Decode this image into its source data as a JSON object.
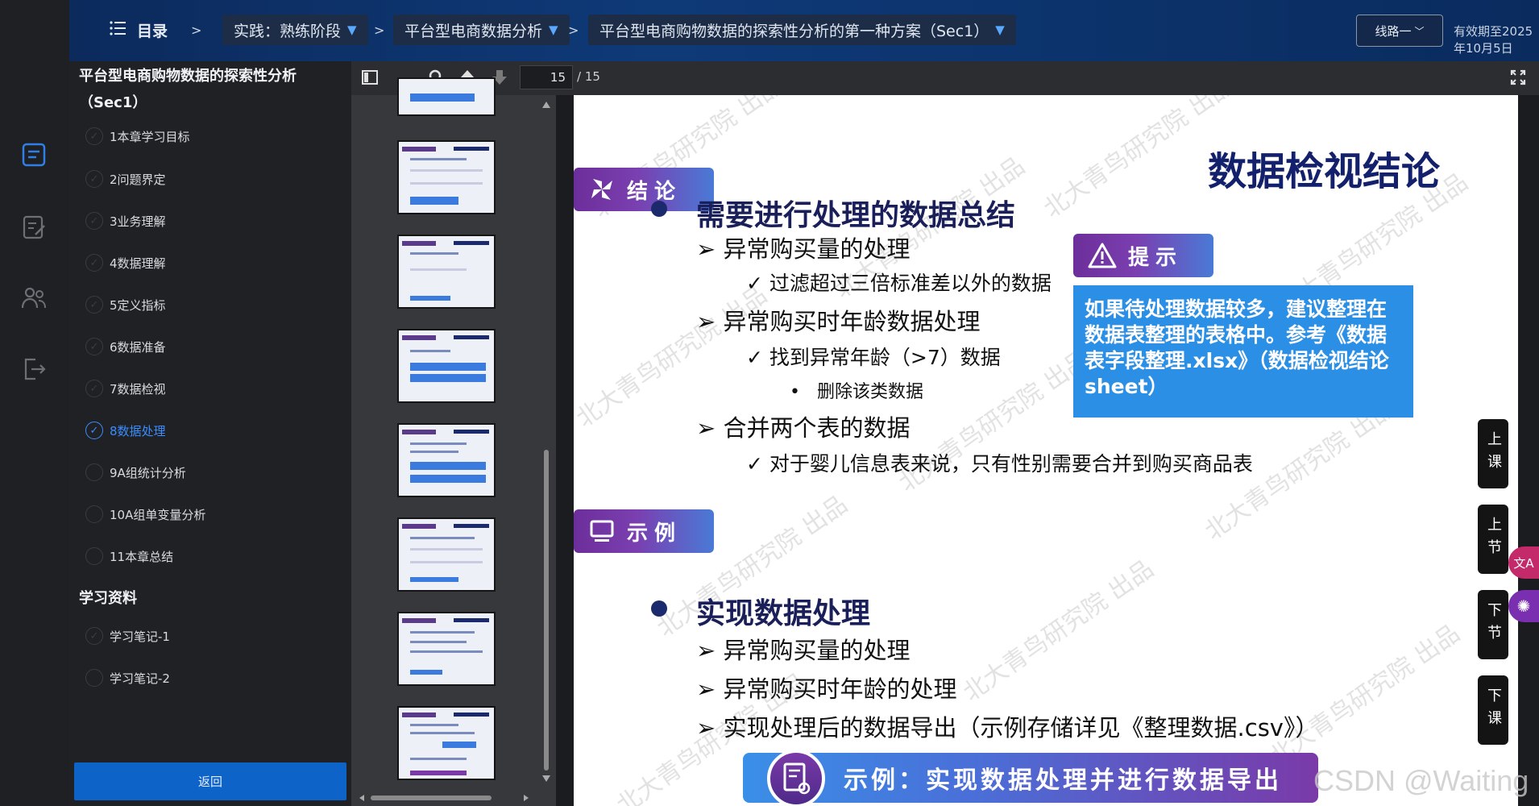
{
  "header": {
    "menu_label": "目录",
    "breadcrumbs": [
      "实践：熟练阶段",
      "平台型电商数据分析",
      "平台型电商购物数据的探索性分析的第一种方案（Sec1）"
    ],
    "route_button": "线路一",
    "validity": "有效期至2025年10月5日"
  },
  "sidebar": {
    "course_title": "平台型电商购物数据的探索性分析（Sec1）",
    "chapters": [
      {
        "label": "1本章学习目标",
        "state": "done"
      },
      {
        "label": "2问题界定",
        "state": "done"
      },
      {
        "label": "3业务理解",
        "state": "done"
      },
      {
        "label": "4数据理解",
        "state": "done"
      },
      {
        "label": "5定义指标",
        "state": "done"
      },
      {
        "label": "6数据准备",
        "state": "done"
      },
      {
        "label": "7数据检视",
        "state": "done"
      },
      {
        "label": "8数据处理",
        "state": "active"
      },
      {
        "label": "9A组统计分析",
        "state": "todo"
      },
      {
        "label": "10A组单变量分析",
        "state": "todo"
      },
      {
        "label": "11本章总结",
        "state": "todo"
      }
    ],
    "materials_title": "学习资料",
    "materials": [
      {
        "label": "学习笔记-1",
        "state": "done"
      },
      {
        "label": "学习笔记-2",
        "state": "todo"
      }
    ],
    "back_button": "返回"
  },
  "viewer": {
    "current_page": "15",
    "total_pages": "/ 15"
  },
  "slide": {
    "title": "数据检视结论",
    "conclusion_tag": "结论",
    "tip_tag": "提示",
    "example_tag": "示例",
    "section1": {
      "heading": "需要进行处理的数据总结",
      "items": [
        {
          "text": "异常购买量的处理",
          "level": 2
        },
        {
          "text": "过滤超过三倍标准差以外的数据",
          "level": 3
        },
        {
          "text": "异常购买时年龄数据处理",
          "level": 2
        },
        {
          "text": "找到异常年龄（>7）数据",
          "level": 3
        },
        {
          "text": "删除该类数据",
          "level": 4
        },
        {
          "text": "合并两个表的数据",
          "level": 2
        },
        {
          "text": "对于婴儿信息表来说，只有性别需要合并到购买商品表",
          "level": 3
        }
      ]
    },
    "tip_text": "如果待处理数据较多，建议整理在数据表整理的表格中。参考《数据表字段整理.xlsx》（数据检视结论sheet）",
    "section2": {
      "heading": "实现数据处理",
      "items": [
        "异常购买量的处理",
        "异常购买时年龄的处理",
        "实现处理后的数据导出（示例存储详见《整理数据.csv》）"
      ]
    },
    "example_bar": "示例：实现数据处理并进行数据导出",
    "watermark": "北大青鸟研究院 出品"
  },
  "side_nav": [
    "上课",
    "上节",
    "下节",
    "下课"
  ],
  "footer_watermark": "CSDN @Waiting",
  "colors": {
    "header_bg": "#0e3a78",
    "accent_blue": "#0d63c7",
    "active_chapter": "#3a8dff",
    "slide_title": "#13206b",
    "tag_purple": "#6c2e9a",
    "tip_blue": "#2c8fe6"
  },
  "icons": [
    "menu-icon",
    "course-icon",
    "notes-icon",
    "people-icon",
    "exit-icon",
    "sidebar-toggle-icon",
    "search-icon",
    "arrow-up-icon",
    "arrow-down-icon",
    "fullscreen-icon",
    "translate-icon",
    "brain-icon"
  ]
}
